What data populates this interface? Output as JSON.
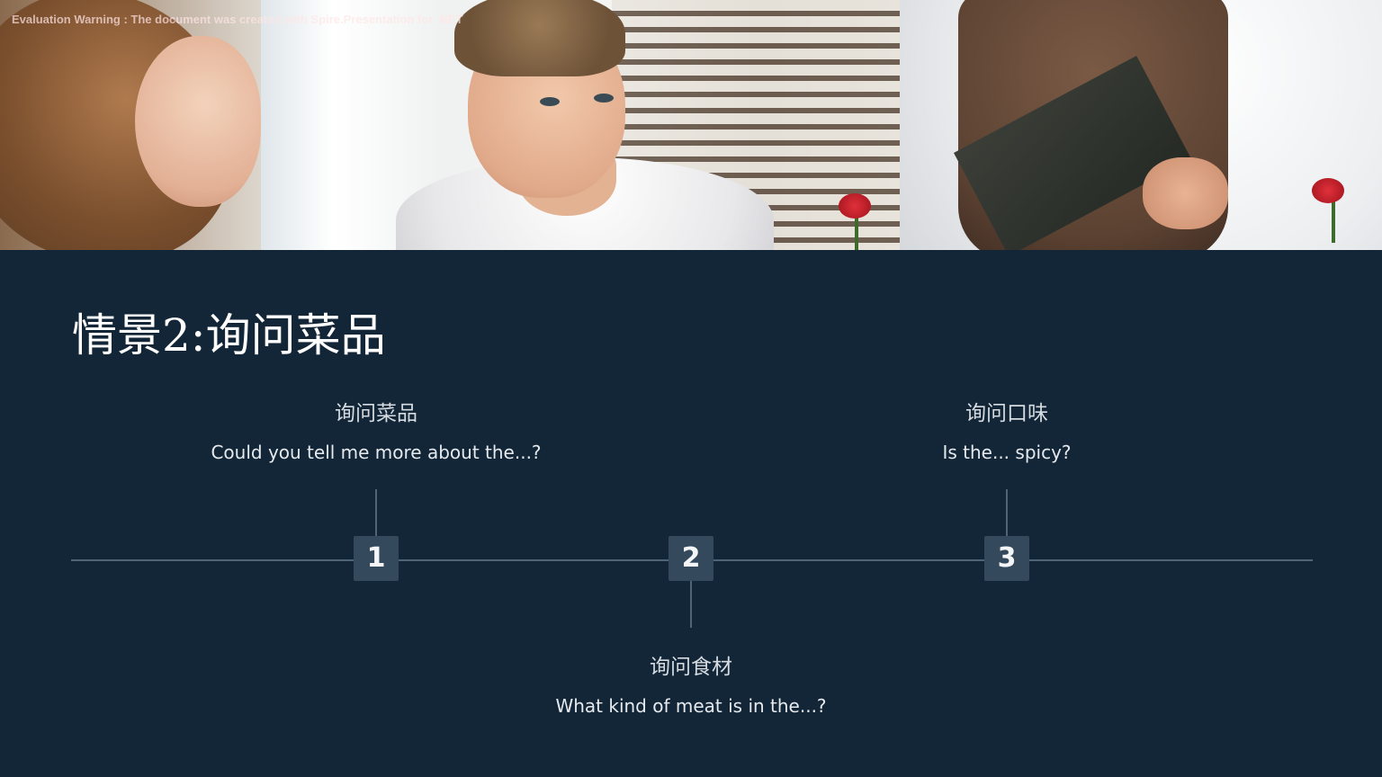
{
  "header_photo": {
    "alt": ""
  },
  "watermark": "Evaluation Warning : The document was created with  Spire.Presentation for .NET",
  "title": "情景2:询问菜品",
  "timeline": {
    "steps": [
      {
        "number": "1",
        "heading": "询问菜品",
        "text": "Could you tell me more about the...?"
      },
      {
        "number": "2",
        "heading": "询问食材",
        "text": "What kind of meat is in the...?"
      },
      {
        "number": "3",
        "heading": "询问口味",
        "text": "Is the... spicy?"
      }
    ]
  },
  "colors": {
    "background": "#132637",
    "marker": "#34495b",
    "line": "#4f6577",
    "title": "#ffffff"
  }
}
